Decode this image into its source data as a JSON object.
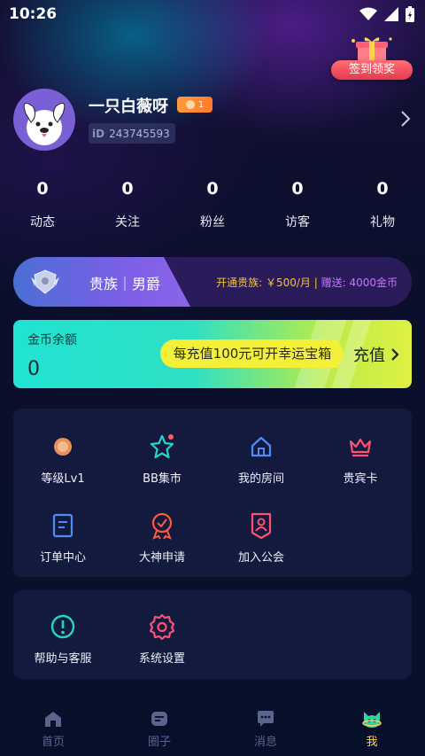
{
  "status": {
    "time": "10:26"
  },
  "gift": {
    "label": "签到领奖"
  },
  "profile": {
    "name": "一只白薇呀",
    "level": "1",
    "id_tag": "iD",
    "id": "243745593"
  },
  "stats": [
    {
      "value": "0",
      "label": "动态"
    },
    {
      "value": "0",
      "label": "关注"
    },
    {
      "value": "0",
      "label": "粉丝"
    },
    {
      "value": "0",
      "label": "访客"
    },
    {
      "value": "0",
      "label": "礼物"
    }
  ],
  "noble": {
    "title": "贵族｜男爵",
    "promo_a": "开通贵族: ￥500/月",
    "promo_sep": " | ",
    "promo_b": "赠送: 4000金币"
  },
  "coins": {
    "title": "金币余额",
    "value": "0",
    "promo": "每充值100元可开幸运宝箱",
    "recharge": "充值"
  },
  "grid": [
    {
      "label": "等级Lv1",
      "icon": "level-coin-icon"
    },
    {
      "label": "BB集市",
      "icon": "star-market-icon"
    },
    {
      "label": "我的房间",
      "icon": "home-icon"
    },
    {
      "label": "贵宾卡",
      "icon": "crown-icon"
    },
    {
      "label": "订单中心",
      "icon": "order-icon"
    },
    {
      "label": "大神申请",
      "icon": "medal-icon"
    },
    {
      "label": "加入公会",
      "icon": "guild-icon"
    }
  ],
  "grid2": [
    {
      "label": "帮助与客服",
      "icon": "help-icon"
    },
    {
      "label": "系统设置",
      "icon": "settings-gear-icon"
    }
  ],
  "tabs": [
    {
      "label": "首页",
      "icon": "home-tab-icon"
    },
    {
      "label": "圈子",
      "icon": "circle-tab-icon"
    },
    {
      "label": "消息",
      "icon": "message-tab-icon"
    },
    {
      "label": "我",
      "icon": "me-tab-icon"
    }
  ],
  "colors": {
    "accent": "#ffd24a",
    "tab_inactive": "#5b648d",
    "coin_start": "#21e3d3",
    "coin_end": "#e0f044",
    "gift": "#e53a4c"
  }
}
